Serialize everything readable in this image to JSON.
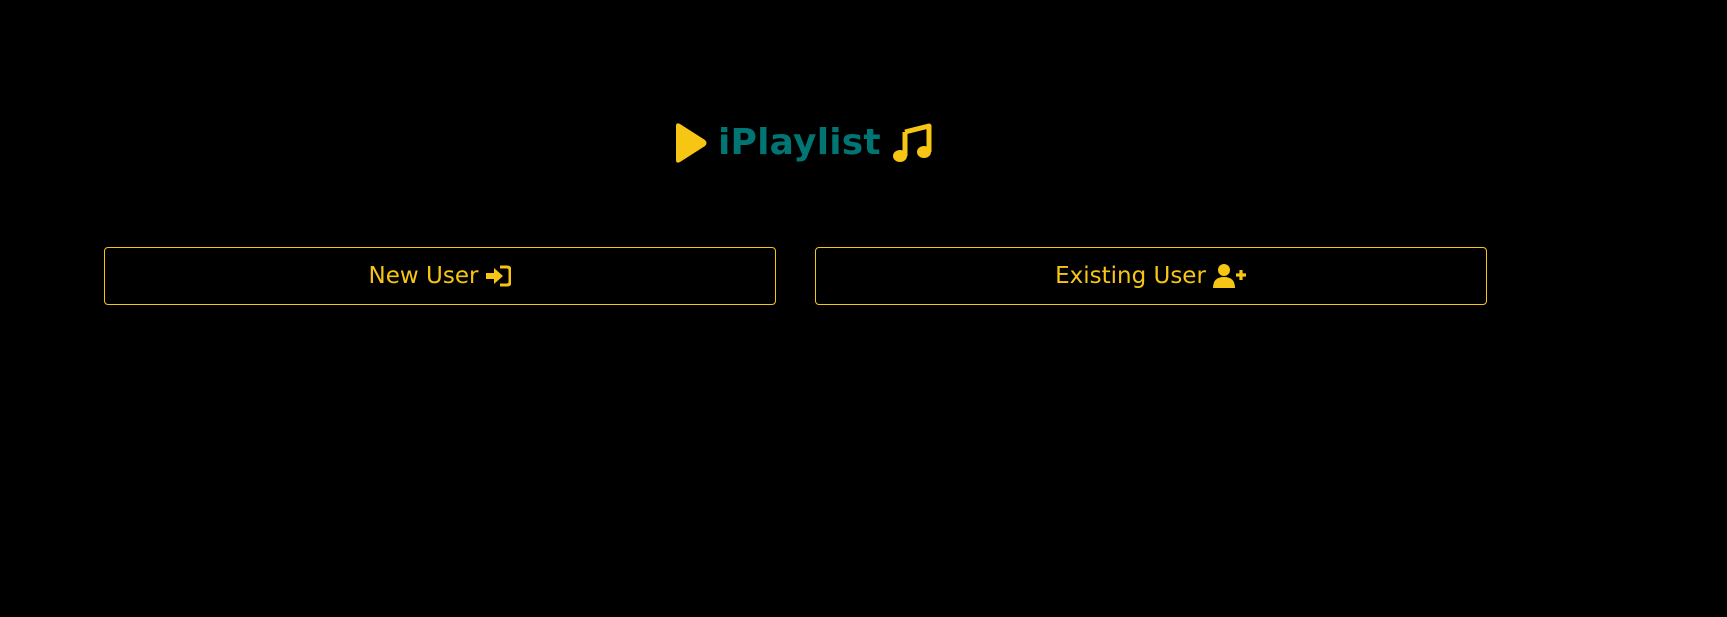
{
  "brand": {
    "title": "iPlaylist",
    "leading_icon": "play-icon",
    "trailing_icon": "music-note-icon"
  },
  "actions": {
    "new_user": {
      "label": "New User",
      "icon": "sign-in-icon"
    },
    "existing_user": {
      "label": "Existing User",
      "icon": "user-plus-icon"
    }
  },
  "colors": {
    "background": "#000000",
    "accent": "#f7c615",
    "title": "#007574"
  }
}
